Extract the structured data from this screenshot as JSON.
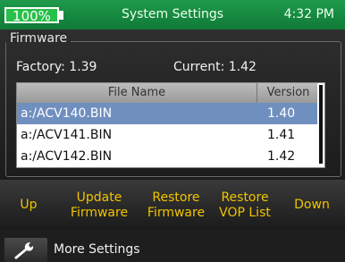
{
  "status_bar": {
    "battery_label": "100%",
    "battery_level": 1.0,
    "title": "System Settings",
    "time": "4:32 PM"
  },
  "firmware": {
    "group_title": "Firmware",
    "factory_text": "Factory: 1.39",
    "current_text": "Current: 1.42",
    "columns": [
      "File Name",
      "Version"
    ],
    "rows": [
      {
        "file": "a:/ACV140.BIN",
        "version": "1.40",
        "selected": true
      },
      {
        "file": "a:/ACV141.BIN",
        "version": "1.41",
        "selected": false
      },
      {
        "file": "a:/ACV142.BIN",
        "version": "1.42",
        "selected": false
      }
    ]
  },
  "softkeys": [
    {
      "name": "up-softkey",
      "label": "Up"
    },
    {
      "name": "update-firmware-softkey",
      "label": "Update\nFirmware"
    },
    {
      "name": "restore-firmware-softkey",
      "label": "Restore\nFirmware"
    },
    {
      "name": "restore-vop-list-softkey",
      "label": "Restore\nVOP List"
    },
    {
      "name": "down-softkey",
      "label": "Down"
    }
  ],
  "footer": {
    "more_settings_label": "More Settings",
    "icon": "wrench-icon"
  },
  "colors": {
    "status_bar": "#1a8a44",
    "softkey_text": "#f0c400",
    "selected_row": "#6f8fbf"
  }
}
